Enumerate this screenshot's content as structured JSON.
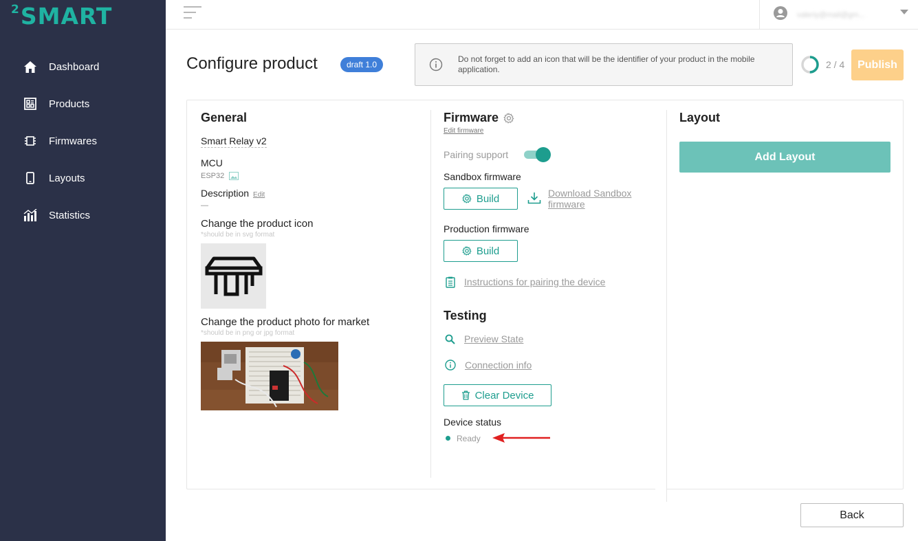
{
  "brand": {
    "logo_sup": "2",
    "logo_text": "SMART"
  },
  "sidebar": {
    "items": [
      {
        "label": "Dashboard",
        "icon": "home-icon"
      },
      {
        "label": "Products",
        "icon": "products-icon"
      },
      {
        "label": "Firmwares",
        "icon": "chip-icon"
      },
      {
        "label": "Layouts",
        "icon": "phone-icon"
      },
      {
        "label": "Statistics",
        "icon": "chart-icon"
      }
    ]
  },
  "topbar": {
    "user_email": "valeriy@mail@gm..."
  },
  "header": {
    "title": "Configure product",
    "badge": "draft 1.0",
    "notice": "Do not forget to add an icon that will be the identifier of your product in the mobile application.",
    "progress_text": "2 / 4",
    "progress_fraction": 0.5,
    "publish_label": "Publish"
  },
  "general": {
    "title": "General",
    "product_name": "Smart Relay v2",
    "mcu_label": "MCU",
    "mcu_value": "ESP32",
    "description_label": "Description",
    "description_edit": "Edit",
    "description_value": "—",
    "icon_label": "Change the product icon",
    "icon_hint": "*should be in svg format",
    "photo_label": "Change the product photo for market",
    "photo_hint": "*should be in png or jpg format"
  },
  "firmware": {
    "title": "Firmware",
    "edit_link": "Edit firmware",
    "pairing_label": "Pairing support",
    "pairing_enabled": true,
    "sandbox_label": "Sandbox firmware",
    "build_label": "Build",
    "download_sandbox": "Download Sandbox firmware",
    "download_line1": "Download Sandbox",
    "download_line2": "firmware",
    "production_label": "Production firmware",
    "instructions_link": "Instructions for pairing the device"
  },
  "testing": {
    "title": "Testing",
    "preview_state": "Preview State",
    "connection_info": "Connection info",
    "clear_device": "Clear Device",
    "device_status_label": "Device status",
    "device_status_value": "Ready"
  },
  "layout": {
    "title": "Layout",
    "add_layout": "Add Layout"
  },
  "footer": {
    "back_label": "Back"
  },
  "colors": {
    "sidebar_bg": "#2b3148",
    "brand_teal": "#1fb3a2",
    "accent_teal": "#1d9d8e",
    "badge_blue": "#3f7fd9",
    "publish_disabled": "#fdd08a",
    "add_layout_bg": "#6cc2b8",
    "annotation_arrow": "#e02020"
  }
}
